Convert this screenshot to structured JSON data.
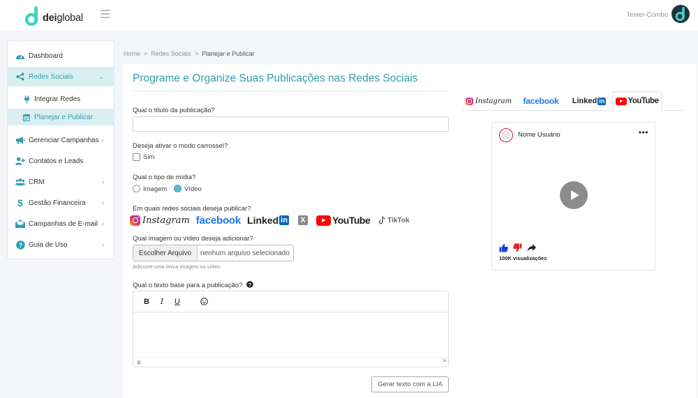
{
  "header": {
    "logo_text_bold": "dei",
    "logo_text": "global",
    "user_name": "Tester-Combo"
  },
  "sidebar": {
    "items": [
      {
        "label": "Dashboard",
        "icon": "dashboard-icon"
      },
      {
        "label": "Redes Sociais",
        "icon": "share-icon",
        "active": true,
        "expanded": true
      },
      {
        "label": "Gerenciar Campanhas",
        "icon": "megaphone-icon"
      },
      {
        "label": "Contatos e Leads",
        "icon": "user-plus-icon"
      },
      {
        "label": "CRM",
        "icon": "users-icon"
      },
      {
        "label": "Gestão Financeira",
        "icon": "dollar-icon"
      },
      {
        "label": "Campanhas de E-mail",
        "icon": "mail-icon"
      },
      {
        "label": "Guia de Uso",
        "icon": "question-icon"
      }
    ],
    "subitems": [
      {
        "label": "Integrar Redes",
        "icon": "plug-icon"
      },
      {
        "label": "Planejar e Publicar",
        "icon": "calendar-icon",
        "active": true
      }
    ]
  },
  "breadcrumb": {
    "home": "Home",
    "section": "Redes Sociais",
    "current": "Planejar e Publicar",
    "separator": ">"
  },
  "page": {
    "title": "Programe e Organize Suas Publicações nas Redes Sociais"
  },
  "form": {
    "title_question": "Qual o título da publicação?",
    "title_value": "",
    "carousel_question": "Deseja ativar o modo carrossel?",
    "carousel_option": "Sim",
    "carousel_checked": false,
    "media_question": "Qual o tipo de mídia?",
    "media_options": [
      "Imagem",
      "Vídeo"
    ],
    "media_selected": "Vídeo",
    "networks_question": "Em quais redes sociais deseja publicar?",
    "networks": {
      "instagram": "Instagram",
      "facebook": "facebook",
      "linkedin_main": "Linked",
      "linkedin_box": "in",
      "x": "X",
      "youtube": "YouTube",
      "tiktok": "TikTok"
    },
    "upload_question": "Qual imagem ou vídeo deseja adicionar?",
    "upload_button": "Escolher Arquivo",
    "upload_status": "nenhum arquivo selecionado",
    "upload_hint": "Adicione uma única imagem ou vídeo.",
    "text_question": "Qual o texto base para a publicação?",
    "editor_toolbar": {
      "bold": "B",
      "italic": "I",
      "underline": "U"
    },
    "editor_status": "p",
    "lia_button": "Gerar texto com a LIA"
  },
  "preview": {
    "tabs": {
      "instagram": "Instagram",
      "facebook": "facebook",
      "linkedin_main": "Linked",
      "linkedin_box": "in",
      "youtube": "YouTube"
    },
    "active_tab": "YouTube",
    "user_name": "Nome Usuário",
    "menu_dots": "•••",
    "views": "100K visualizações"
  },
  "colors": {
    "accent": "#2f9db0",
    "active_bg": "#d9eef1",
    "facebook": "#1877f2",
    "youtube": "#ff0000",
    "linkedin": "#0a66c2",
    "like": "#1a3fd6",
    "dislike": "#e02424"
  }
}
